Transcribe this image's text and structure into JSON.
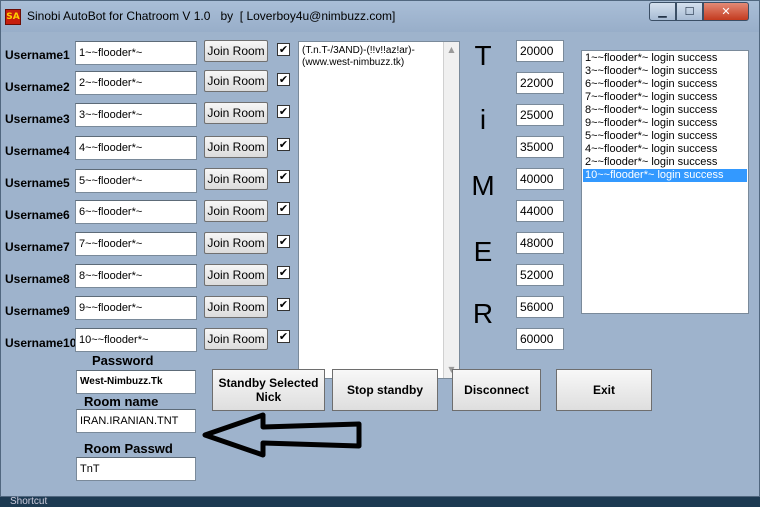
{
  "window": {
    "title": "Sinobi AutoBot for Chatroom V 1.0   by  [ Loverboy4u@nimbuzz.com]",
    "icon_text": "SA",
    "min_glyph": "▁",
    "max_glyph": "☐",
    "close_glyph": "✕"
  },
  "users": [
    {
      "label": "Username1",
      "value": "1~~flooder*~",
      "join": "Join Room",
      "checked": "✔"
    },
    {
      "label": "Username2",
      "value": "2~~flooder*~",
      "join": "Join Room",
      "checked": "✔"
    },
    {
      "label": "Username3",
      "value": "3~~flooder*~",
      "join": "Join Room",
      "checked": "✔"
    },
    {
      "label": "Username4",
      "value": "4~~flooder*~",
      "join": "Join Room",
      "checked": "✔"
    },
    {
      "label": "Username5",
      "value": "5~~flooder*~",
      "join": "Join Room",
      "checked": "✔"
    },
    {
      "label": "Username6",
      "value": "6~~flooder*~",
      "join": "Join Room",
      "checked": "✔"
    },
    {
      "label": "Username7",
      "value": "7~~flooder*~",
      "join": "Join Room",
      "checked": "✔"
    },
    {
      "label": "Username8",
      "value": "8~~flooder*~",
      "join": "Join Room",
      "checked": "✔"
    },
    {
      "label": "Username9",
      "value": "9~~flooder*~",
      "join": "Join Room",
      "checked": "✔"
    },
    {
      "label": "Username10",
      "value": "10~~flooder*~",
      "join": "Join Room",
      "checked": "✔"
    }
  ],
  "memo": {
    "text": "(T.n.T-/3AND)-(!!v!!az!ar)-(www.west-nimbuzz.tk)",
    "scroll_up": "▲",
    "scroll_down": "▼"
  },
  "timer_letters": [
    "T",
    "i",
    "M",
    "E",
    "R"
  ],
  "timer_values": [
    "20000",
    "22000",
    "25000",
    "35000",
    "40000",
    "44000",
    "48000",
    "52000",
    "56000",
    "60000"
  ],
  "log": {
    "items": [
      "1~~flooder*~ login success",
      "3~~flooder*~ login success",
      "6~~flooder*~ login success",
      "7~~flooder*~ login success",
      "8~~flooder*~ login success",
      "9~~flooder*~ login success",
      "5~~flooder*~ login success",
      "4~~flooder*~ login success",
      "2~~flooder*~ login success",
      "10~~flooder*~ login success"
    ],
    "selected_index": 9
  },
  "password": {
    "label": "Password",
    "value": "West-Nimbuzz.Tk"
  },
  "room_name": {
    "label": "Room name",
    "value": "IRAN.IRANIAN.TNT"
  },
  "room_pass": {
    "label": "Room Passwd",
    "value": "TnT"
  },
  "buttons": {
    "standby": "Standby Selected Nick",
    "stop": "Stop standby",
    "disconnect": "Disconnect",
    "exit": "Exit"
  },
  "taskbar_peek": "Shortcut",
  "colors": {
    "window_bg": "#9eb3cc",
    "selection": "#3399ff",
    "close_button": "#c43b1f"
  }
}
